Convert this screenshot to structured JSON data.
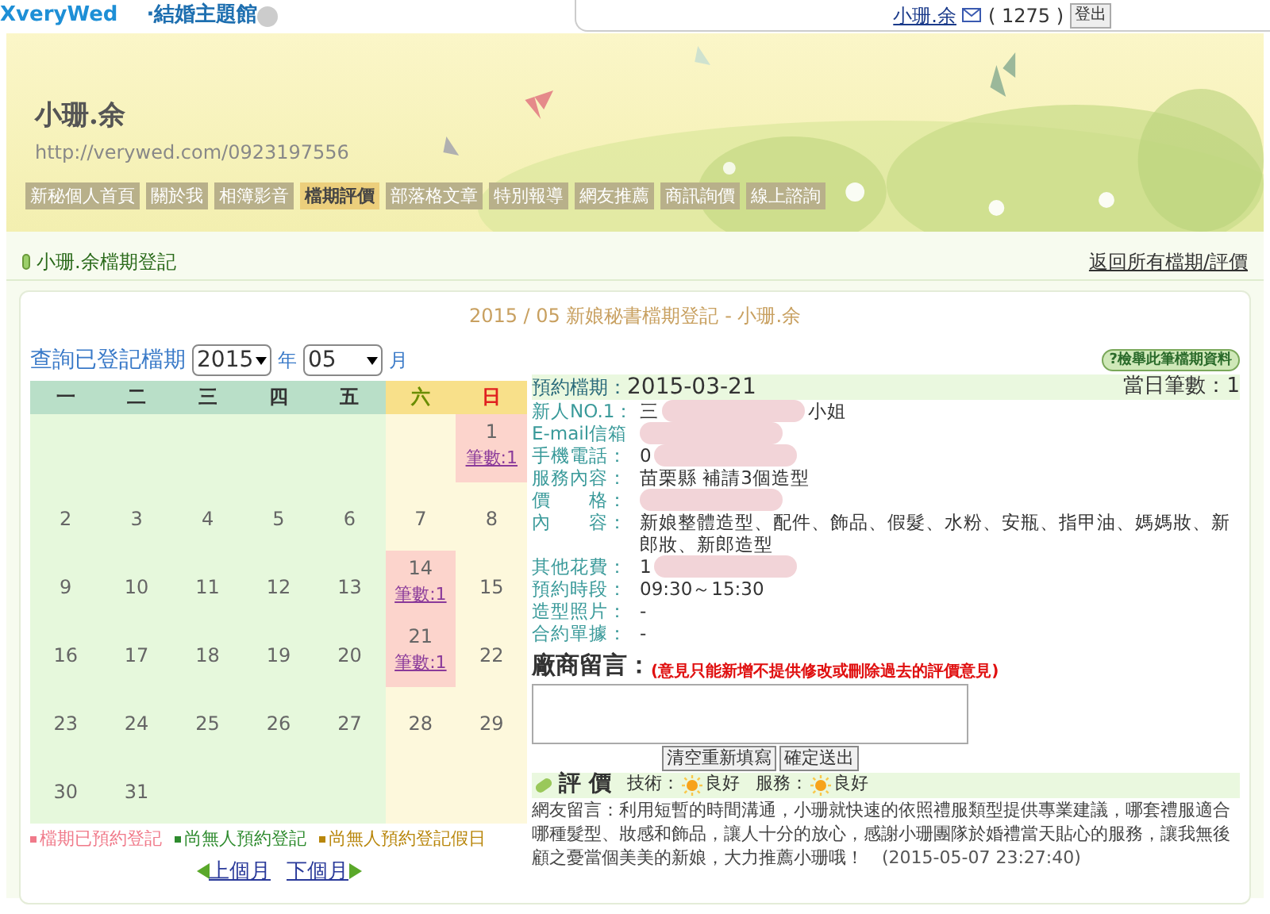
{
  "topbar": {
    "logo": "XveryWed",
    "site_menu": "·結婚主題館",
    "user": "小珊.余",
    "message_count": "( 1275 )",
    "logout": "登出"
  },
  "banner": {
    "name": "小珊.余",
    "url": "http://verywed.com/0923197556",
    "tabs": [
      {
        "label": "新秘個人首頁",
        "selected": false
      },
      {
        "label": "關於我",
        "selected": false
      },
      {
        "label": "相簿影音",
        "selected": false
      },
      {
        "label": "檔期評價",
        "selected": true
      },
      {
        "label": "部落格文章",
        "selected": false
      },
      {
        "label": "特別報導",
        "selected": false
      },
      {
        "label": "網友推薦",
        "selected": false
      },
      {
        "label": "商訊詢價",
        "selected": false
      },
      {
        "label": "線上諮詢",
        "selected": false
      }
    ]
  },
  "section": {
    "title": "小珊.余檔期登記",
    "back_link": "返回所有檔期/評價"
  },
  "card": {
    "heading": "2015 / 05 新娘秘書檔期登記 - 小珊.余",
    "query": {
      "label": "查詢已登記檔期",
      "year": "2015",
      "year_unit": "年",
      "month": "05",
      "month_unit": "月"
    },
    "calendar": {
      "columns": [
        {
          "label": "一",
          "kind": "weekday"
        },
        {
          "label": "二",
          "kind": "weekday"
        },
        {
          "label": "三",
          "kind": "weekday"
        },
        {
          "label": "四",
          "kind": "weekday"
        },
        {
          "label": "五",
          "kind": "weekday"
        },
        {
          "label": "六",
          "kind": "saturday"
        },
        {
          "label": "日",
          "kind": "sunday"
        }
      ],
      "weeks": [
        [
          {
            "kind": "blank"
          },
          {
            "kind": "blank"
          },
          {
            "kind": "blank"
          },
          {
            "kind": "blank"
          },
          {
            "kind": "blank"
          },
          {
            "kind": "blank"
          },
          {
            "kind": "day",
            "day": "1",
            "booked": true,
            "link": "筆數:1"
          }
        ],
        [
          {
            "kind": "day",
            "day": "2",
            "booked": false
          },
          {
            "kind": "day",
            "day": "3",
            "booked": false
          },
          {
            "kind": "day",
            "day": "4",
            "booked": false
          },
          {
            "kind": "day",
            "day": "5",
            "booked": false
          },
          {
            "kind": "day",
            "day": "6",
            "booked": false
          },
          {
            "kind": "day",
            "day": "7",
            "booked": false
          },
          {
            "kind": "day",
            "day": "8",
            "booked": false
          }
        ],
        [
          {
            "kind": "day",
            "day": "9",
            "booked": false
          },
          {
            "kind": "day",
            "day": "10",
            "booked": false
          },
          {
            "kind": "day",
            "day": "11",
            "booked": false
          },
          {
            "kind": "day",
            "day": "12",
            "booked": false
          },
          {
            "kind": "day",
            "day": "13",
            "booked": false
          },
          {
            "kind": "day",
            "day": "14",
            "booked": true,
            "link": "筆數:1"
          },
          {
            "kind": "day",
            "day": "15",
            "booked": false
          }
        ],
        [
          {
            "kind": "day",
            "day": "16",
            "booked": false
          },
          {
            "kind": "day",
            "day": "17",
            "booked": false
          },
          {
            "kind": "day",
            "day": "18",
            "booked": false
          },
          {
            "kind": "day",
            "day": "19",
            "booked": false
          },
          {
            "kind": "day",
            "day": "20",
            "booked": false
          },
          {
            "kind": "day",
            "day": "21",
            "booked": true,
            "link": "筆數:1"
          },
          {
            "kind": "day",
            "day": "22",
            "booked": false
          }
        ],
        [
          {
            "kind": "day",
            "day": "23",
            "booked": false
          },
          {
            "kind": "day",
            "day": "24",
            "booked": false
          },
          {
            "kind": "day",
            "day": "25",
            "booked": false
          },
          {
            "kind": "day",
            "day": "26",
            "booked": false
          },
          {
            "kind": "day",
            "day": "27",
            "booked": false
          },
          {
            "kind": "day",
            "day": "28",
            "booked": false
          },
          {
            "kind": "day",
            "day": "29",
            "booked": false
          }
        ],
        [
          {
            "kind": "day",
            "day": "30",
            "booked": false
          },
          {
            "kind": "day",
            "day": "31",
            "booked": false
          },
          {
            "kind": "blank"
          },
          {
            "kind": "blank"
          },
          {
            "kind": "blank"
          },
          {
            "kind": "blank"
          },
          {
            "kind": "blank"
          }
        ]
      ]
    },
    "legend": [
      {
        "label": "檔期已預約登記",
        "color": "#f07a8a"
      },
      {
        "label": "尚無人預約登記",
        "color": "#2e8b2e"
      },
      {
        "label": "尚無人預約登記假日",
        "color": "#b8860b"
      }
    ],
    "pager": {
      "prev": "上個月",
      "next": "下個月"
    },
    "detail": {
      "report_button": "?檢舉此筆檔期資料",
      "date_label": "預約檔期：",
      "date": "2015-03-21",
      "count_label": "當日筆數：",
      "count": "1",
      "fields": [
        {
          "label": "新人NO.1：",
          "parts": [
            {
              "kind": "text",
              "text": "三"
            },
            {
              "kind": "redacted"
            },
            {
              "kind": "text",
              "text": "小姐"
            }
          ]
        },
        {
          "label": "E-mail信箱",
          "parts": [
            {
              "kind": "redacted"
            }
          ]
        },
        {
          "label": "手機電話：",
          "parts": [
            {
              "kind": "text",
              "text": "0"
            },
            {
              "kind": "redacted"
            }
          ]
        },
        {
          "label": "服務內容：",
          "parts": [
            {
              "kind": "text",
              "text": "苗栗縣 補請3個造型"
            }
          ]
        },
        {
          "label": "價　　格：",
          "parts": [
            {
              "kind": "redacted"
            }
          ]
        },
        {
          "label": "內　　容：",
          "parts": [
            {
              "kind": "text",
              "text": "新娘整體造型、配件、飾品、假髮、水粉、安瓶、指甲油、媽媽妝、新郎妝、新郎造型"
            }
          ]
        },
        {
          "label": "其他花費：",
          "parts": [
            {
              "kind": "text",
              "text": "1"
            },
            {
              "kind": "redacted"
            }
          ]
        },
        {
          "label": "預約時段：",
          "parts": [
            {
              "kind": "text",
              "text": "09:30～15:30"
            }
          ]
        },
        {
          "label": "造型照片：",
          "parts": [
            {
              "kind": "text",
              "text": "-"
            }
          ]
        },
        {
          "label": "合約單據：",
          "parts": [
            {
              "kind": "text",
              "text": "-"
            }
          ]
        }
      ],
      "comment_label": "廠商留言：",
      "comment_note": "(意見只能新增不提供修改或刪除過去的評價意見)",
      "buttons": [
        "清空重新填寫",
        "確定送出"
      ],
      "rating": {
        "title": "評 價",
        "items": [
          {
            "label": "技術：",
            "value": "良好"
          },
          {
            "label": "服務：",
            "value": "良好"
          }
        ]
      },
      "review": {
        "text": "網友留言：利用短暫的時間溝通，小珊就快速的依照禮服類型提供專業建議，哪套禮服適合哪種髮型、妝感和飾品，讓人十分的放心，感謝小珊團隊於婚禮當天貼心的服務，讓我無後顧之憂當個美美的新娘，大力推薦小珊哦！",
        "time": "(2015-05-07 23:27:40)"
      }
    }
  }
}
